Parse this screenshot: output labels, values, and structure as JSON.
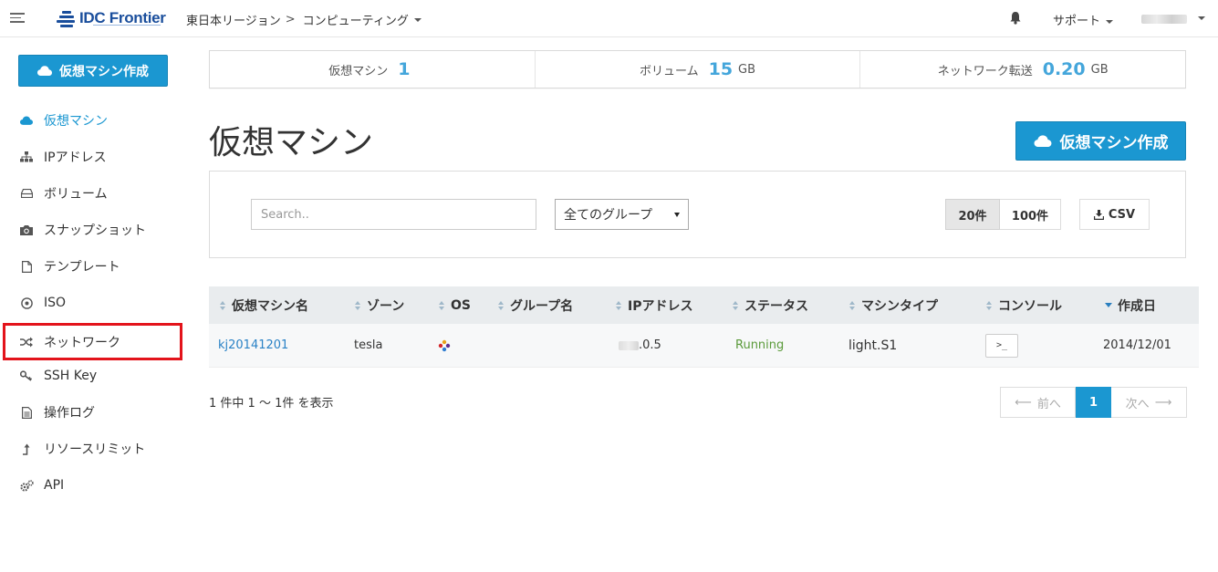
{
  "header": {
    "logo_text": "IDC Frontier",
    "breadcrumb": {
      "region": "東日本リージョン",
      "separator": ">",
      "service": "コンピューティング"
    },
    "support_label": "サポート"
  },
  "sidebar": {
    "create_button": "仮想マシン作成",
    "items": [
      {
        "label": "仮想マシン",
        "icon": "cloud-icon"
      },
      {
        "label": "IPアドレス",
        "icon": "sitemap-icon"
      },
      {
        "label": "ボリューム",
        "icon": "hdd-icon"
      },
      {
        "label": "スナップショット",
        "icon": "camera-icon"
      },
      {
        "label": "テンプレート",
        "icon": "file-icon"
      },
      {
        "label": "ISO",
        "icon": "disc-icon"
      },
      {
        "label": "ネットワーク",
        "icon": "random-icon"
      },
      {
        "label": "SSH Key",
        "icon": "key-icon"
      },
      {
        "label": "操作ログ",
        "icon": "document-icon"
      },
      {
        "label": "リソースリミット",
        "icon": "level-up-icon"
      },
      {
        "label": "API",
        "icon": "cogs-icon"
      }
    ]
  },
  "stats": [
    {
      "label": "仮想マシン",
      "value": "1",
      "unit": ""
    },
    {
      "label": "ボリューム",
      "value": "15",
      "unit": "GB"
    },
    {
      "label": "ネットワーク転送",
      "value": "0.20",
      "unit": "GB"
    }
  ],
  "main": {
    "title": "仮想マシン",
    "create_button": "仮想マシン作成",
    "search_placeholder": "Search..",
    "group_select": "全てのグループ",
    "page_size": {
      "selected": "20件",
      "other": "100件"
    },
    "csv_label": "CSV"
  },
  "table": {
    "columns": [
      "仮想マシン名",
      "ゾーン",
      "OS",
      "グループ名",
      "IPアドレス",
      "ステータス",
      "マシンタイプ",
      "コンソール",
      "作成日"
    ],
    "rows": [
      {
        "name": "kj20141201",
        "zone": "tesla",
        "os": "os-icon",
        "group": "",
        "ip_suffix": ".0.5",
        "status": "Running",
        "machine_type": "light.S1",
        "console": ">_",
        "created": "2014/12/01"
      }
    ]
  },
  "footer": {
    "count_text": "1 件中 1 ～ 1件 を表示",
    "prev": "前へ",
    "current_page": "1",
    "next": "次へ"
  },
  "colors": {
    "primary": "#1b97d1",
    "link": "#2a82c6",
    "running": "#5a9a3a",
    "highlight": "#e3131b"
  }
}
